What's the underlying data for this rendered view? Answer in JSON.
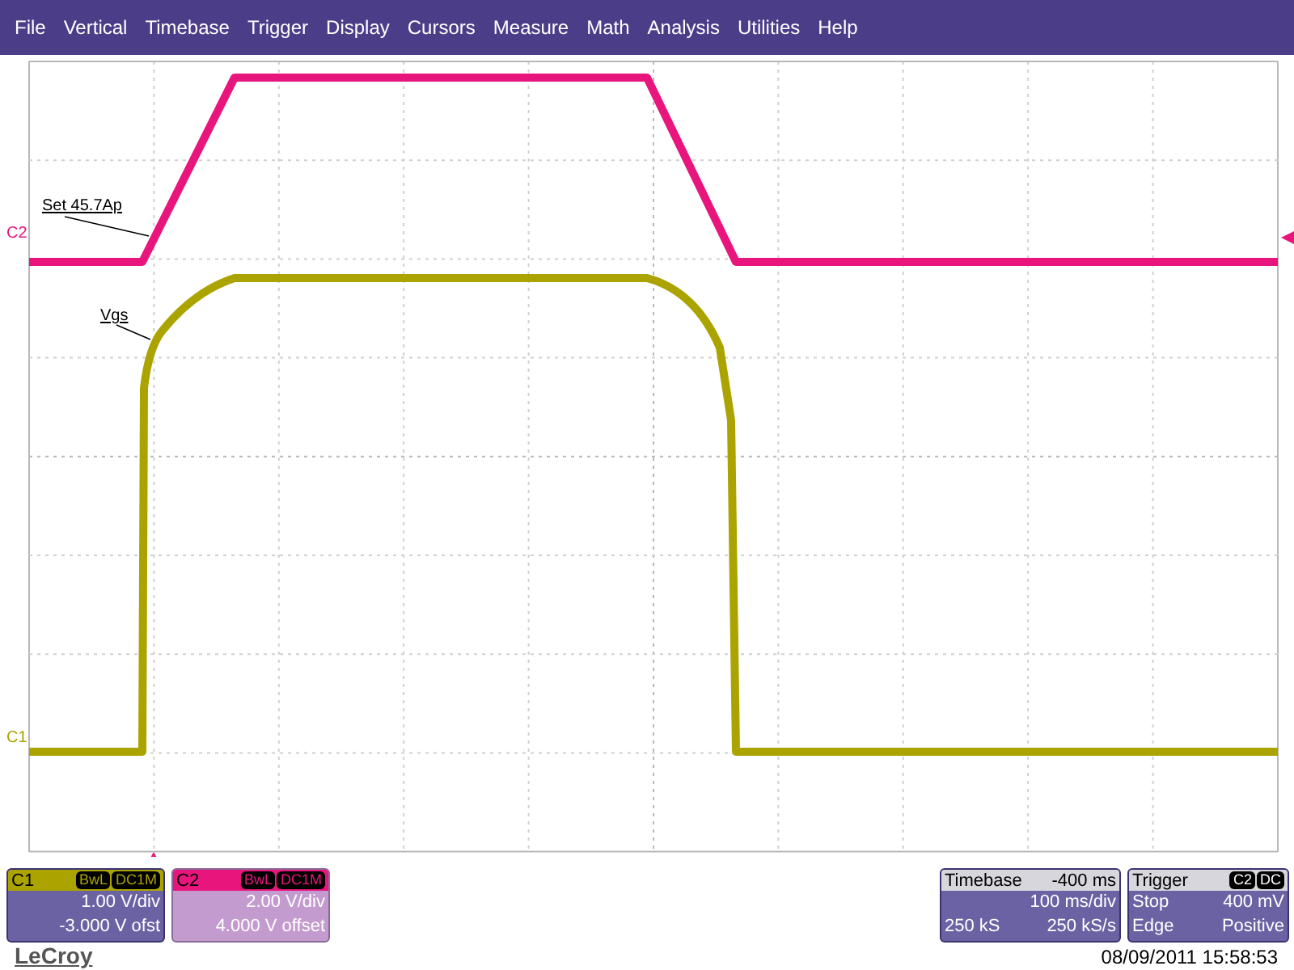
{
  "menu": [
    "File",
    "Vertical",
    "Timebase",
    "Trigger",
    "Display",
    "Cursors",
    "Measure",
    "Math",
    "Analysis",
    "Utilities",
    "Help"
  ],
  "traces": [
    {
      "label": "C2",
      "color": "#e8157c"
    },
    {
      "label": "C1",
      "color": "#aba400"
    }
  ],
  "annotations": [
    {
      "text": "Set 45.7Ap"
    },
    {
      "text": "Vgs"
    }
  ],
  "channels": [
    {
      "name": "C1",
      "color": "#aba400",
      "selected": false,
      "tags": [
        "BwL",
        "DC1M"
      ],
      "scale": "1.00 V/div",
      "offset": "-3.000 V ofst"
    },
    {
      "name": "C2",
      "color": "#e8157c",
      "selected": true,
      "tags": [
        "BwL",
        "DC1M"
      ],
      "scale": "2.00 V/div",
      "offset": "4.000 V offset"
    }
  ],
  "timebase": {
    "title": "Timebase",
    "delay": "-400 ms",
    "per_div": "100 ms/div",
    "samples": "250 kS",
    "rate": "250 kS/s"
  },
  "trigger": {
    "title": "Trigger",
    "tags": [
      "C2",
      "DC"
    ],
    "mode": "Stop",
    "level": "400 mV",
    "type": "Edge",
    "slope": "Positive"
  },
  "brand": "LeCroy",
  "timestamp": "08/09/2011 15:58:53"
}
